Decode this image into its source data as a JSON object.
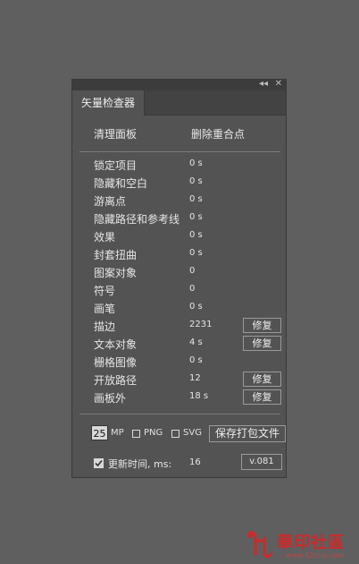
{
  "panel": {
    "tab_title": "矢量检查器",
    "collapse_glyph": "◂◂",
    "close_glyph": "✕"
  },
  "top_actions": {
    "cleanup": "清理面板",
    "delete_overlap": "删除重合点"
  },
  "rows": [
    {
      "label": "锁定项目",
      "value": "0 s",
      "fix": null
    },
    {
      "label": "隐藏和空白",
      "value": "0 s",
      "fix": null
    },
    {
      "label": "游离点",
      "value": "0 s",
      "fix": null
    },
    {
      "label": "隐藏路径和参考线",
      "value": "0 s",
      "fix": null
    },
    {
      "label": "效果",
      "value": "0 s",
      "fix": null
    },
    {
      "label": "封套扭曲",
      "value": "0 s",
      "fix": null
    },
    {
      "label": "图案对象",
      "value": "0",
      "fix": null
    },
    {
      "label": "符号",
      "value": "0",
      "fix": null
    },
    {
      "label": "画笔",
      "value": "0 s",
      "fix": null
    },
    {
      "label": "描边",
      "value": "2231",
      "fix": "修复"
    },
    {
      "label": "文本对象",
      "value": "4 s",
      "fix": "修复"
    },
    {
      "label": "栅格图像",
      "value": "0 s",
      "fix": null
    },
    {
      "label": "开放路径",
      "value": "12",
      "fix": "修复"
    },
    {
      "label": "画板外",
      "value": "18 s",
      "fix": "修复"
    }
  ],
  "footer": {
    "mp_value": "25",
    "mp_label": "MP",
    "png_label": "PNG",
    "png_checked": false,
    "svg_label": "SVG",
    "svg_checked": false,
    "save_label": "保存打包文件",
    "update_checked": true,
    "update_label": "更新时间, ms:",
    "update_value": "16",
    "version": "v.081"
  },
  "watermark": {
    "text": "華印社區",
    "url": "www.52cnp.com"
  },
  "colors": {
    "background": "#5f5f5f",
    "panel": "#535353",
    "watermark": "#cc2a2a"
  }
}
